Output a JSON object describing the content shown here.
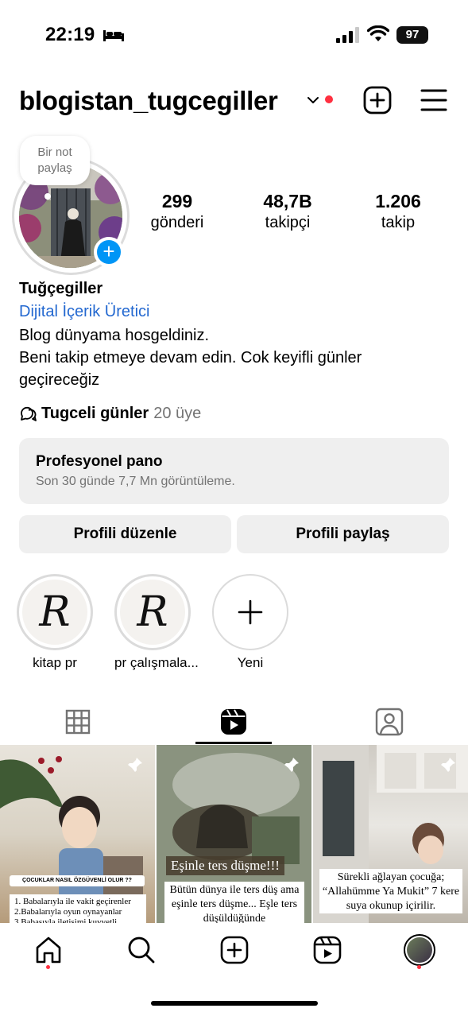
{
  "status_bar": {
    "time": "22:19",
    "battery": "97"
  },
  "header": {
    "username": "blogistan_tugcegiller"
  },
  "note": {
    "text_line1": "Bir not",
    "text_line2": "paylaş"
  },
  "stats": [
    {
      "value": "299",
      "label": "gönderi"
    },
    {
      "value": "48,7B",
      "label": "takipçi"
    },
    {
      "value": "1.206",
      "label": "takip"
    }
  ],
  "profile": {
    "name": "Tuğçegiller",
    "category": "Dijital İçerik Üretici",
    "bio_line1": "Blog dünyama hosgeldiniz.",
    "bio_line2": "Beni takip etmeye devam edin. Cok keyifli günler geçireceğiz"
  },
  "community": {
    "name": "Tugceli günler",
    "members": "20 üye"
  },
  "dashboard": {
    "title": "Profesyonel pano",
    "subtitle": "Son 30 günde 7,7 Mn görüntüleme."
  },
  "buttons": {
    "edit": "Profili düzenle",
    "share": "Profili paylaş"
  },
  "highlights": [
    {
      "label": "kitap pr",
      "monogram": "R"
    },
    {
      "label": "pr çalışmala...",
      "monogram": "R"
    },
    {
      "label": "Yeni"
    }
  ],
  "tabs": {
    "active": "reels"
  },
  "posts": [
    {
      "headline": "ÇOCUKLAR NASIL ÖZGÜVENLİ OLUR ??",
      "body": "1. Babalarıyla ile vakit geçirenler 2.Babalarıyla oyun oynayanlar 3.Babasıyla iletişimi kuvvetli"
    },
    {
      "headline": "Eşinle ters düşme!!!",
      "body": "Bütün dünya ile ters düş ama eşinle ters düşme... Eşle ters düşüldüğünde"
    },
    {
      "headline": "",
      "body": "Sürekli ağlayan çocuğa; “Allahümme Ya Mukit” 7 kere suya okunup içirilir."
    }
  ],
  "colors": {
    "accent_blue": "#0095f6",
    "link_blue": "#2368d0",
    "notification_red": "#ff3040"
  }
}
